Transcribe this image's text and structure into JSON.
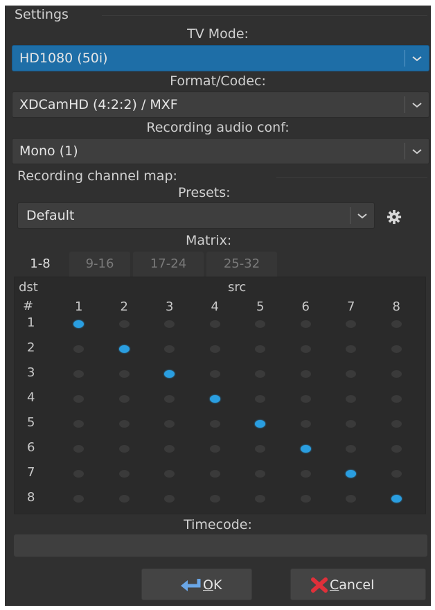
{
  "group_title": "Settings",
  "tv_mode": {
    "label": "TV Mode:",
    "value": "HD1080 (50i)"
  },
  "format_codec": {
    "label": "Format/Codec:",
    "value": "XDCamHD (4:2:2) / MXF"
  },
  "audio_conf": {
    "label": "Recording audio conf:",
    "value": "Mono (1)"
  },
  "channel_map": {
    "title": "Recording channel map:",
    "presets_label": "Presets:",
    "preset_value": "Default",
    "matrix_label": "Matrix:",
    "tabs": [
      "1-8",
      "9-16",
      "17-24",
      "25-32"
    ],
    "active_tab": "1-8",
    "dst_label": "dst",
    "src_label": "src",
    "hash_label": "#",
    "src_cols": [
      "1",
      "2",
      "3",
      "4",
      "5",
      "6",
      "7",
      "8"
    ],
    "dst_rows": [
      "1",
      "2",
      "3",
      "4",
      "5",
      "6",
      "7",
      "8"
    ],
    "mapping": [
      [
        1,
        1
      ],
      [
        2,
        2
      ],
      [
        3,
        3
      ],
      [
        4,
        4
      ],
      [
        5,
        5
      ],
      [
        6,
        6
      ],
      [
        7,
        7
      ],
      [
        8,
        8
      ]
    ]
  },
  "timecode": {
    "label": "Timecode:",
    "value": ""
  },
  "buttons": {
    "ok_prefix": "",
    "ok_mnemonic": "O",
    "ok_rest": "K",
    "cancel_mnemonic": "C",
    "cancel_rest": "ancel"
  },
  "colors": {
    "accent": "#1e6ea7",
    "dot_on": "#2a9ee0",
    "dot_off": "#3a3a3a"
  },
  "icons": {
    "combo_arrow": "chevron-down-icon",
    "gear": "gear-icon",
    "ok": "return-arrow-icon",
    "cancel": "x-cross-icon"
  }
}
